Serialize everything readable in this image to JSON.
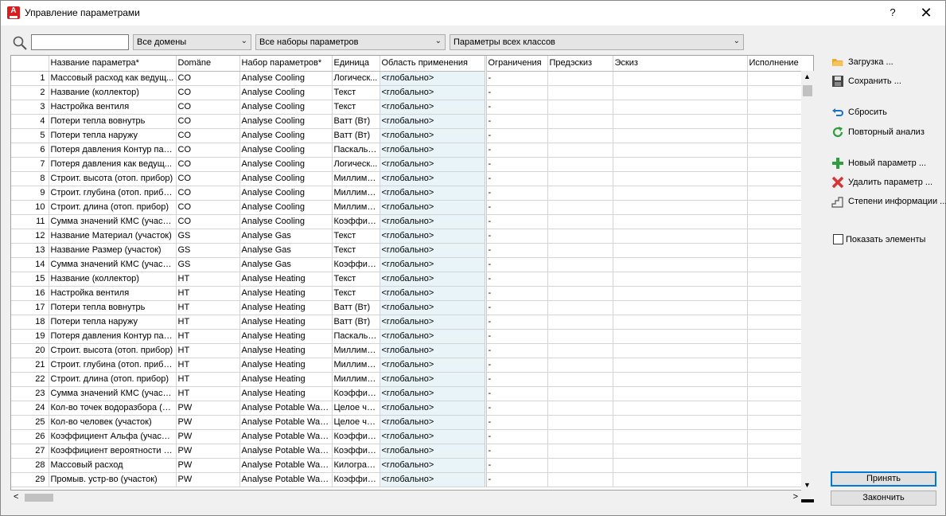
{
  "window": {
    "title": "Управление параметрами",
    "help": "?",
    "close": "✕"
  },
  "filters": {
    "search_value": "",
    "domains": "Все домены",
    "sets": "Все наборы параметров",
    "classes": "Параметры всех классов"
  },
  "columns": [
    "",
    "Название параметра*",
    "Domäne",
    "Набор параметров*",
    "Единица",
    "Область применения",
    "Ограничения",
    "Предэскиз",
    "Эскиз",
    "Исполнение"
  ],
  "rows": [
    [
      "1",
      "Массовый расход как ведущ...",
      "CO",
      "Analyse Cooling",
      "Логическ...",
      "<глобально>",
      "-"
    ],
    [
      "2",
      "Название (коллектор)",
      "CO",
      "Analyse Cooling",
      "Текст",
      "<глобально>",
      "-"
    ],
    [
      "3",
      "Настройка вентиля",
      "CO",
      "Analyse Cooling",
      "Текст",
      "<глобально>",
      "-"
    ],
    [
      "4",
      "Потери тепла вовнутрь",
      "CO",
      "Analyse Cooling",
      "Ватт (Вт)",
      "<глобально>",
      "-"
    ],
    [
      "5",
      "Потери тепла наружу",
      "CO",
      "Analyse Cooling",
      "Ватт (Вт)",
      "<глобально>",
      "-"
    ],
    [
      "6",
      "Потеря давления Контур пан...",
      "CO",
      "Analyse Cooling",
      "Паскаль (...",
      "<глобально>",
      "-"
    ],
    [
      "7",
      "Потеря давления как ведущ...",
      "CO",
      "Analyse Cooling",
      "Логическ...",
      "<глобально>",
      "-"
    ],
    [
      "8",
      "Строит. высота (отоп. прибор)",
      "CO",
      "Analyse Cooling",
      "Миллиме...",
      "<глобально>",
      "-"
    ],
    [
      "9",
      "Строит. глубина (отоп. прибор)",
      "CO",
      "Analyse Cooling",
      "Миллиме...",
      "<глобально>",
      "-"
    ],
    [
      "10",
      "Строит. длина (отоп. прибор)",
      "CO",
      "Analyse Cooling",
      "Миллиме...",
      "<глобально>",
      "-"
    ],
    [
      "11",
      "Сумма значений КМС (участок)",
      "CO",
      "Analyse Cooling",
      "Коэффиц...",
      "<глобально>",
      "-"
    ],
    [
      "12",
      "Название Материал (участок)",
      "GS",
      "Analyse Gas",
      "Текст",
      "<глобально>",
      "-"
    ],
    [
      "13",
      "Название Размер (участок)",
      "GS",
      "Analyse Gas",
      "Текст",
      "<глобально>",
      "-"
    ],
    [
      "14",
      "Сумма значений КМС (участок)",
      "GS",
      "Analyse Gas",
      "Коэффиц...",
      "<глобально>",
      "-"
    ],
    [
      "15",
      "Название (коллектор)",
      "HT",
      "Analyse Heating",
      "Текст",
      "<глобально>",
      "-"
    ],
    [
      "16",
      "Настройка вентиля",
      "HT",
      "Analyse Heating",
      "Текст",
      "<глобально>",
      "-"
    ],
    [
      "17",
      "Потери тепла вовнутрь",
      "HT",
      "Analyse Heating",
      "Ватт (Вт)",
      "<глобально>",
      "-"
    ],
    [
      "18",
      "Потери тепла наружу",
      "HT",
      "Analyse Heating",
      "Ватт (Вт)",
      "<глобально>",
      "-"
    ],
    [
      "19",
      "Потеря давления Контур пан...",
      "HT",
      "Analyse Heating",
      "Паскаль (...",
      "<глобально>",
      "-"
    ],
    [
      "20",
      "Строит. высота (отоп. прибор)",
      "HT",
      "Analyse Heating",
      "Миллиме...",
      "<глобально>",
      "-"
    ],
    [
      "21",
      "Строит. глубина (отоп. прибор)",
      "HT",
      "Analyse Heating",
      "Миллиме...",
      "<глобально>",
      "-"
    ],
    [
      "22",
      "Строит. длина (отоп. прибор)",
      "HT",
      "Analyse Heating",
      "Миллиме...",
      "<глобально>",
      "-"
    ],
    [
      "23",
      "Сумма значений КМС (участок)",
      "HT",
      "Analyse Heating",
      "Коэффиц...",
      "<глобально>",
      "-"
    ],
    [
      "24",
      "Кол-во точек водоразбора (уч...",
      "PW",
      "Analyse Potable Water",
      "Целое чи...",
      "<глобально>",
      "-"
    ],
    [
      "25",
      "Кол-во человек (участок)",
      "PW",
      "Analyse Potable Water",
      "Целое чи...",
      "<глобально>",
      "-"
    ],
    [
      "26",
      "Коэффициент Альфа (участок)",
      "PW",
      "Analyse Potable Water",
      "Коэффиц...",
      "<глобально>",
      "-"
    ],
    [
      "27",
      "Коэффициент вероятности (у...",
      "PW",
      "Analyse Potable Water",
      "Коэффиц...",
      "<глобально>",
      "-"
    ],
    [
      "28",
      "Массовый расход",
      "PW",
      "Analyse Potable Water",
      "Килограм...",
      "<глобально>",
      "-"
    ],
    [
      "29",
      "Промыв. устр-во (участок)",
      "PW",
      "Analyse Potable Water",
      "Коэффиц...",
      "<глобально>",
      "-"
    ]
  ],
  "actions": {
    "load": "Загрузка ...",
    "save": "Сохранить ...",
    "reset": "Сбросить",
    "reanalyze": "Повторный анализ",
    "new_param": "Новый параметр ...",
    "delete_param": "Удалить параметр ...",
    "info_levels": "Степени информации ...",
    "show_elements": "Показать элементы"
  },
  "buttons": {
    "accept": "Принять",
    "finish": "Закончить"
  },
  "colors": {
    "accent": "#0078d7",
    "scope_bg": "#e8f4f8",
    "title_icon": "#d81e1e"
  },
  "icons": {
    "load": "folder-open-icon",
    "save": "floppy-disk-icon",
    "reset": "undo-arrow-icon",
    "reanalyze": "refresh-icon",
    "new_param": "plus-icon",
    "delete_param": "delete-x-icon",
    "info_levels": "stairs-icon",
    "search": "search-icon"
  }
}
